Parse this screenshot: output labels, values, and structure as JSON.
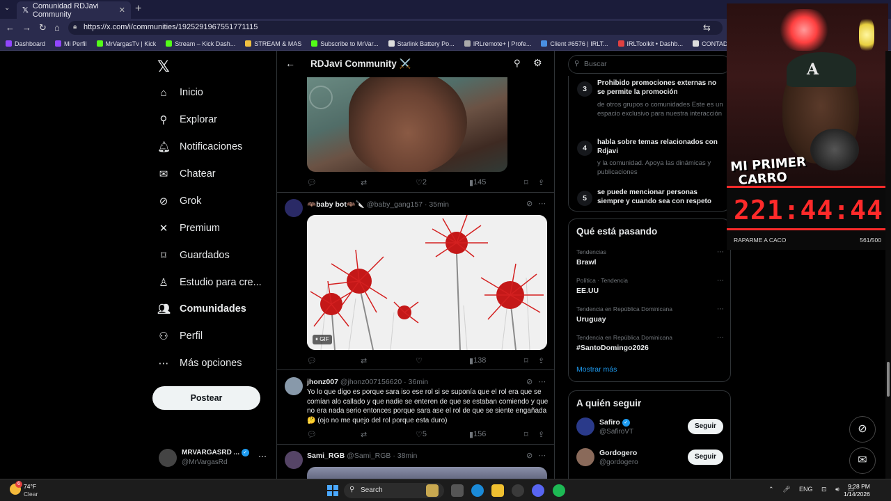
{
  "browser": {
    "tab_title": "Comunidad RDJavi Community",
    "url": "https://x.com/i/communities/1925291967551771115",
    "bookmarks": [
      {
        "label": "Dashboard",
        "color": "#9146ff"
      },
      {
        "label": "Mi Perfil",
        "color": "#9146ff"
      },
      {
        "label": "MrVargasTv | Kick",
        "color": "#53fc18"
      },
      {
        "label": "Stream – Kick Dash...",
        "color": "#53fc18"
      },
      {
        "label": "STREAM & MAS",
        "color": "#f0c040"
      },
      {
        "label": "Subscribe to MrVar...",
        "color": "#53fc18"
      },
      {
        "label": "Starlink Battery Po...",
        "color": "#dddddd"
      },
      {
        "label": "IRLremote+ | Profe...",
        "color": "#aaaaaa"
      },
      {
        "label": "Client #6576 | IRLT...",
        "color": "#4a90e2"
      },
      {
        "label": "IRLToolkit • Dashb...",
        "color": "#e04040"
      },
      {
        "label": "CONTADOR",
        "color": "#dddddd"
      }
    ]
  },
  "nav": {
    "items": [
      {
        "label": "Inicio",
        "icon": "home-icon",
        "glyph": "⌂"
      },
      {
        "label": "Explorar",
        "icon": "search-icon",
        "glyph": "⚲"
      },
      {
        "label": "Notificaciones",
        "icon": "bell-icon",
        "glyph": "🔔︎"
      },
      {
        "label": "Chatear",
        "icon": "mail-icon",
        "glyph": "✉"
      },
      {
        "label": "Grok",
        "icon": "grok-icon",
        "glyph": "⊘"
      },
      {
        "label": "Premium",
        "icon": "x-icon",
        "glyph": "✕"
      },
      {
        "label": "Guardados",
        "icon": "bookmark-icon",
        "glyph": "⌑"
      },
      {
        "label": "Estudio para cre...",
        "icon": "studio-icon",
        "glyph": "♙"
      },
      {
        "label": "Comunidades",
        "icon": "communities-icon",
        "glyph": "👥︎"
      },
      {
        "label": "Perfil",
        "icon": "profile-icon",
        "glyph": "⚇"
      },
      {
        "label": "Más opciones",
        "icon": "more-icon",
        "glyph": "⋯"
      }
    ],
    "post_label": "Postear",
    "account_name": "MRVARGASRD ...",
    "account_handle": "@MrVargasRd"
  },
  "header": {
    "title": "RDJavi Community ⚔️"
  },
  "tweets": [
    {
      "likes": "2",
      "views": "145"
    },
    {
      "author": "🦇baby bot🦇🔪",
      "handle": "@baby_gang157",
      "time": "· 35min",
      "gif_label": "GIF",
      "likes": "",
      "views": "138"
    },
    {
      "author": "jhonz007",
      "handle": "@jhonz007156620",
      "time": "· 36min",
      "text": "Yo lo que digo es porque sara iso ese rol si se suponía que el rol era que se comían  alo callado y que nadie se enteren de que se estaban comiendo y que no era nada serio entonces porque sara ase el rol de que se siente engañada 🤔 (ojo no me quejo del rol porque esta duro)",
      "likes": "5",
      "views": "156"
    },
    {
      "author": "Sami_RGB",
      "handle": "@Sami_RGB",
      "time": "· 38min"
    }
  ],
  "right": {
    "search_placeholder": "Buscar",
    "rules": [
      {
        "num": "3",
        "title": "Prohibido promociones externas no se permite la promoción",
        "desc": "de otros grupos o comunidades Este es un espacio exclusivo para nuestra interacción"
      },
      {
        "num": "4",
        "title": "habla sobre temas relacionados con Rdjavi",
        "desc": "y la comunidad. Apoya las dinámicas y publicaciones"
      },
      {
        "num": "5",
        "title": "se puede mencionar personas siempre y cuando sea con respeto",
        "desc": ""
      }
    ],
    "trends_title": "Qué está pasando",
    "trends": [
      {
        "context": "Tendencias",
        "name": "Brawl"
      },
      {
        "context": "Política · Tendencia",
        "name": "EE.UU"
      },
      {
        "context": "Tendencia en República Dominicana",
        "name": "Uruguay"
      },
      {
        "context": "Tendencia en República Dominicana",
        "name": "#SantoDomingo2026"
      }
    ],
    "show_more": "Mostrar más",
    "follow_title": "A quién seguir",
    "follow": [
      {
        "name": "Safiro",
        "handle": "@SafiroVT",
        "button": "Seguir",
        "color": "#2a3a8a"
      },
      {
        "name": "Gordogero",
        "handle": "@gordogero",
        "button": "Seguir",
        "color": "#8a6a5a"
      }
    ]
  },
  "overlay": {
    "sign_line1": "MI PRIMER",
    "sign_line2": "CARRO",
    "timer": "221:44:44",
    "goal_label": "RAPARME A CACO",
    "goal_count": "561/500"
  },
  "taskbar": {
    "weather_badge": "6",
    "temperature": "74°F",
    "condition": "Clear",
    "search_label": "Search",
    "lang": "ENG",
    "time": "9:28 PM",
    "date": "1/14/2026"
  }
}
